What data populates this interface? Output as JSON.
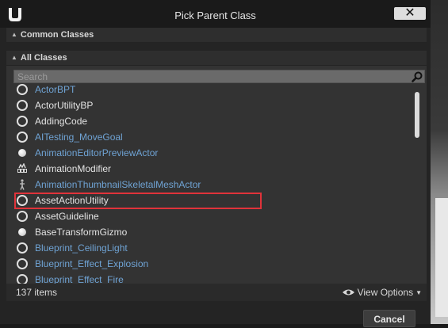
{
  "dialog": {
    "title": "Pick Parent Class",
    "close_label": "✕",
    "common_classes_label": "Common Classes",
    "all_classes_label": "All Classes",
    "search_placeholder": "Search",
    "item_count": "137 items",
    "view_options_label": "View Options",
    "cancel_label": "Cancel"
  },
  "classes": [
    {
      "label": "ActorBPT",
      "kind": "blueprint",
      "icon": "ring-icon"
    },
    {
      "label": "ActorUtilityBP",
      "kind": "native",
      "icon": "ring-icon"
    },
    {
      "label": "AddingCode",
      "kind": "native",
      "icon": "ring-icon"
    },
    {
      "label": "AITesting_MoveGoal",
      "kind": "blueprint",
      "icon": "ring-icon"
    },
    {
      "label": "AnimationEditorPreviewActor",
      "kind": "blueprint",
      "icon": "sphere-icon"
    },
    {
      "label": "AnimationModifier",
      "kind": "native",
      "icon": "animation-modifier-icon"
    },
    {
      "label": "AnimationThumbnailSkeletalMeshActor",
      "kind": "blueprint",
      "icon": "skeletal-mesh-icon"
    },
    {
      "label": "AssetActionUtility",
      "kind": "native",
      "icon": "ring-icon"
    },
    {
      "label": "AssetGuideline",
      "kind": "native",
      "icon": "ring-icon"
    },
    {
      "label": "BaseTransformGizmo",
      "kind": "native",
      "icon": "sphere-icon"
    },
    {
      "label": "Blueprint_CeilingLight",
      "kind": "blueprint",
      "icon": "ring-icon"
    },
    {
      "label": "Blueprint_Effect_Explosion",
      "kind": "blueprint",
      "icon": "ring-icon"
    },
    {
      "label": "Blueprint_Effect_Fire",
      "kind": "blueprint",
      "icon": "ring-icon"
    }
  ],
  "colors": {
    "native_text": "#e4e4e4",
    "blueprint_text": "#6fa3d4",
    "highlight_border": "#e0333a"
  }
}
